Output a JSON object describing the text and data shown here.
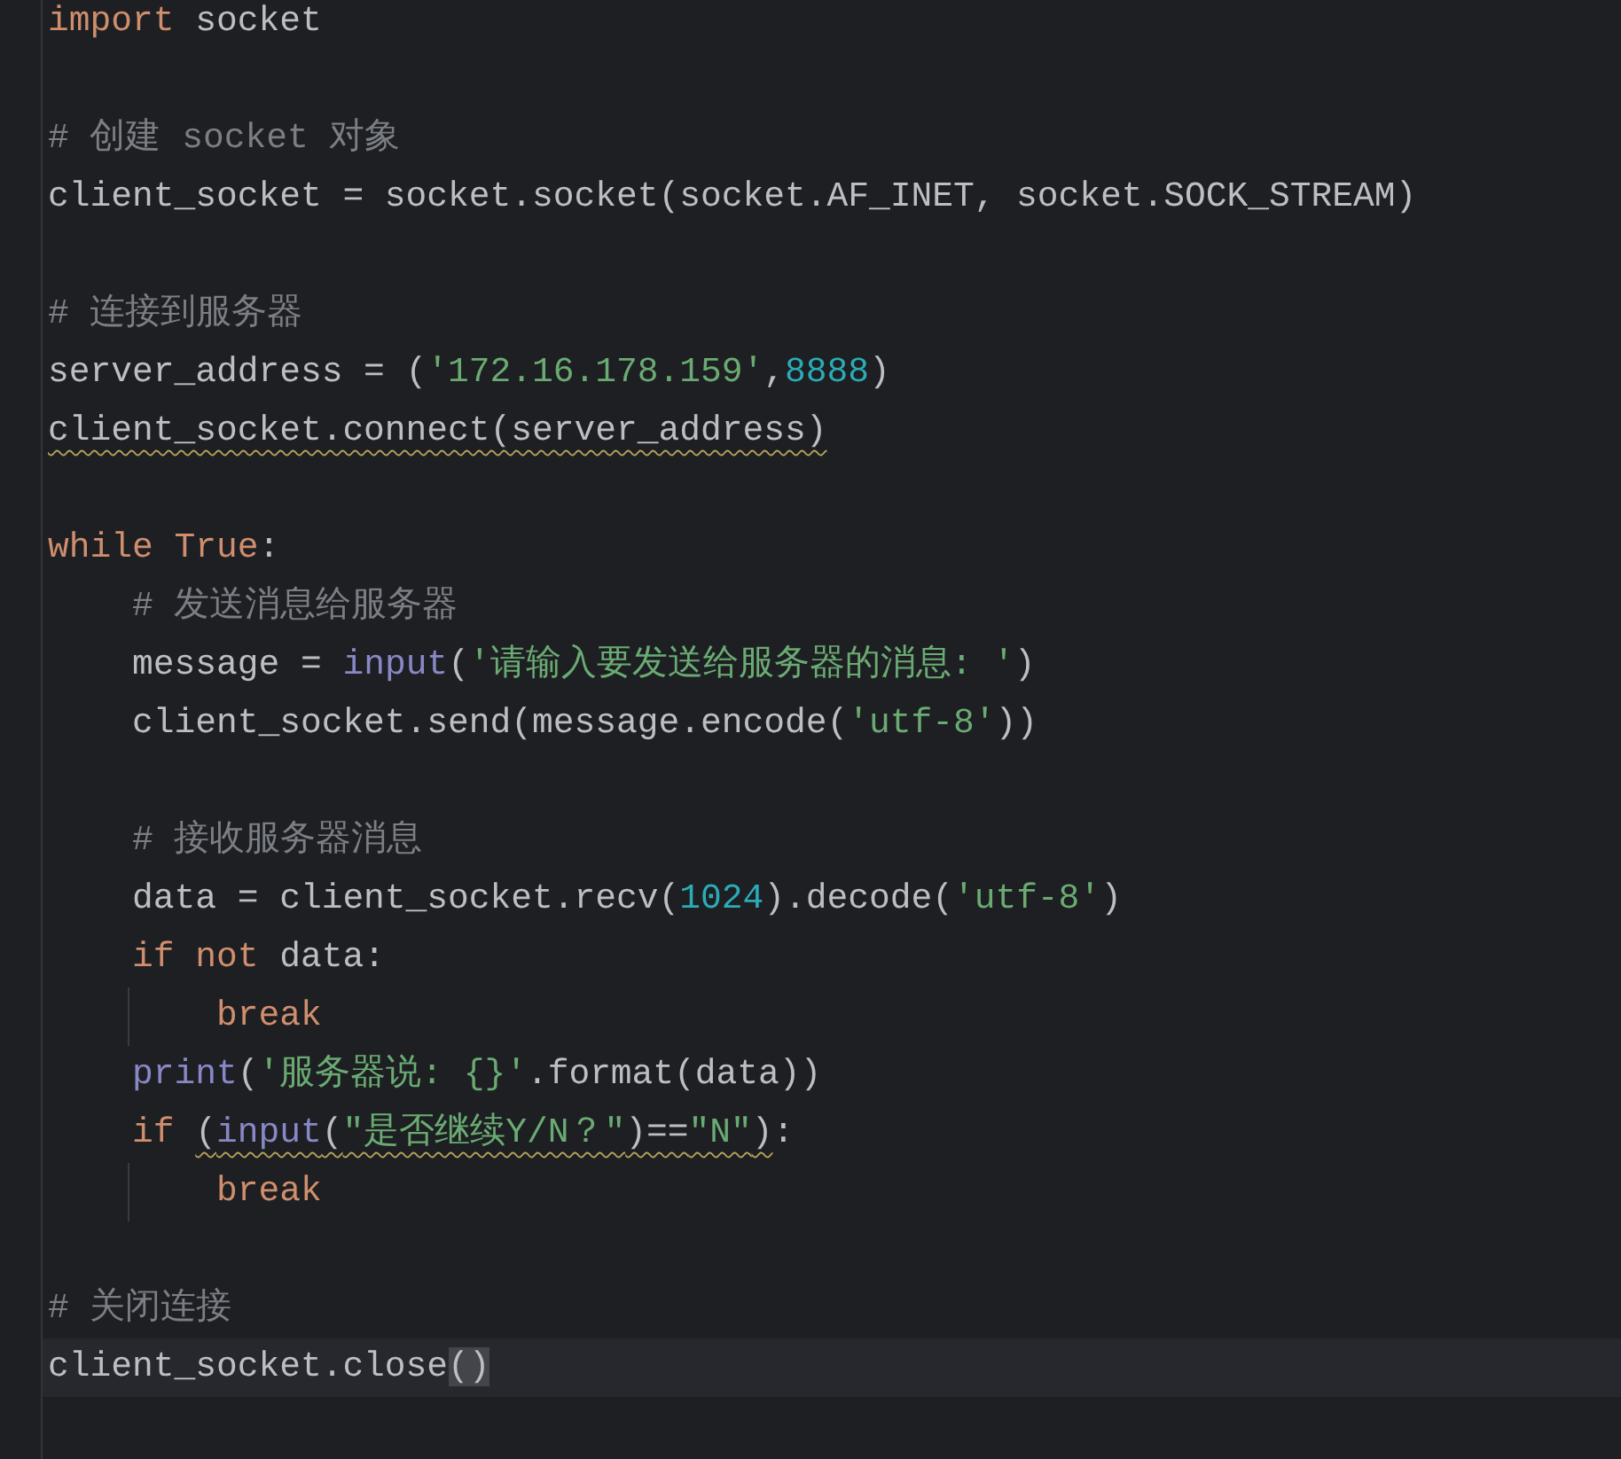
{
  "editor": {
    "lines": [
      {
        "current": false,
        "tokens": [
          {
            "text": "import",
            "kind": "keyword"
          },
          {
            "text": " socket",
            "kind": "plain"
          }
        ]
      },
      {
        "current": false
      },
      {
        "current": false,
        "tokens": [
          {
            "text": "# 创建 socket 对象",
            "kind": "comment"
          }
        ]
      },
      {
        "current": false,
        "tokens": [
          {
            "text": "client_socket = socket.socket(socket.AF_INET, socket.SOCK_STREAM)",
            "kind": "plain"
          }
        ]
      },
      {
        "current": false
      },
      {
        "current": false,
        "tokens": [
          {
            "text": "# 连接到服务器",
            "kind": "comment"
          }
        ]
      },
      {
        "current": false,
        "tokens": [
          {
            "text": "server_address = (",
            "kind": "plain"
          },
          {
            "text": "'172.16.178.159'",
            "kind": "string"
          },
          {
            "text": ",",
            "kind": "plain"
          },
          {
            "text": "8888",
            "kind": "number"
          },
          {
            "text": ")",
            "kind": "plain"
          }
        ]
      },
      {
        "current": false,
        "tokens": [
          {
            "warning": true,
            "tokens": [
              {
                "text": "client_socket.connect(server_address)",
                "kind": "plain"
              }
            ]
          }
        ]
      },
      {
        "current": false
      },
      {
        "current": false,
        "tokens": [
          {
            "text": "while True",
            "kind": "keyword"
          },
          {
            "text": ":",
            "kind": "plain"
          }
        ]
      },
      {
        "current": false,
        "tokens": [
          {
            "text": "    # 发送消息给服务器",
            "kind": "comment"
          }
        ]
      },
      {
        "current": false,
        "tokens": [
          {
            "text": "    message = ",
            "kind": "plain"
          },
          {
            "text": "input",
            "kind": "builtin"
          },
          {
            "text": "(",
            "kind": "plain"
          },
          {
            "text": "'请输入要发送给服务器的消息: '",
            "kind": "string"
          },
          {
            "text": ")",
            "kind": "plain"
          }
        ]
      },
      {
        "current": false,
        "tokens": [
          {
            "text": "    client_socket.send(message.encode(",
            "kind": "plain"
          },
          {
            "text": "'utf-8'",
            "kind": "string"
          },
          {
            "text": "))",
            "kind": "plain"
          }
        ]
      },
      {
        "current": false
      },
      {
        "current": false,
        "tokens": [
          {
            "text": "    # 接收服务器消息",
            "kind": "comment"
          }
        ]
      },
      {
        "current": false,
        "tokens": [
          {
            "text": "    data = client_socket.recv(",
            "kind": "plain"
          },
          {
            "text": "1024",
            "kind": "number"
          },
          {
            "text": ").decode(",
            "kind": "plain"
          },
          {
            "text": "'utf-8'",
            "kind": "string"
          },
          {
            "text": ")",
            "kind": "plain"
          }
        ]
      },
      {
        "current": false,
        "tokens": [
          {
            "text": "    if not",
            "kind": "keyword"
          },
          {
            "text": " data:",
            "kind": "plain"
          }
        ]
      },
      {
        "current": false,
        "indent_guide": true,
        "tokens": [
          {
            "text": "        break",
            "kind": "keyword"
          }
        ]
      },
      {
        "current": false,
        "tokens": [
          {
            "text": "    print",
            "kind": "builtin"
          },
          {
            "text": "(",
            "kind": "plain"
          },
          {
            "text": "'服务器说: {}'",
            "kind": "string"
          },
          {
            "text": ".format(data))",
            "kind": "plain"
          }
        ]
      },
      {
        "current": false,
        "tokens": [
          {
            "text": "    if ",
            "kind": "keyword"
          },
          {
            "warning": true,
            "tokens": [
              {
                "text": "(",
                "kind": "plain"
              },
              {
                "text": "input",
                "kind": "builtin"
              },
              {
                "text": "(",
                "kind": "plain"
              },
              {
                "text": "\"是否继续Y/N？\"",
                "kind": "string"
              },
              {
                "text": ")==",
                "kind": "plain"
              },
              {
                "text": "\"N\"",
                "kind": "string"
              },
              {
                "text": ")",
                "kind": "plain"
              }
            ]
          },
          {
            "text": ":",
            "kind": "plain"
          }
        ]
      },
      {
        "current": false,
        "indent_guide": true,
        "tokens": [
          {
            "text": "        break",
            "kind": "keyword"
          }
        ]
      },
      {
        "current": false
      },
      {
        "current": false,
        "tokens": [
          {
            "text": "# 关闭连接",
            "kind": "comment"
          }
        ]
      },
      {
        "current": true,
        "tokens": [
          {
            "text": "client_socket.close",
            "kind": "plain"
          },
          {
            "text": "()",
            "kind": "plain",
            "bracket_match": true
          }
        ]
      }
    ]
  }
}
